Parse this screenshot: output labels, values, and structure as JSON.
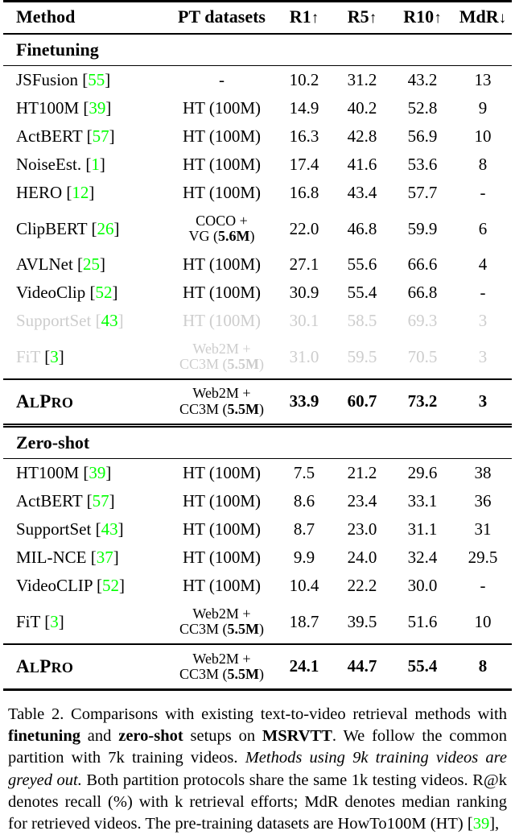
{
  "table": {
    "columns": [
      {
        "key": "method",
        "label": "Method"
      },
      {
        "key": "pt",
        "label": "PT datasets"
      },
      {
        "key": "r1",
        "label": "R1",
        "arrow": "↑"
      },
      {
        "key": "r5",
        "label": "R5",
        "arrow": "↑"
      },
      {
        "key": "r10",
        "label": "R10",
        "arrow": "↑"
      },
      {
        "key": "mdr",
        "label": "MdR",
        "arrow": "↓"
      }
    ],
    "sections": [
      {
        "title": "Finetuning",
        "rows": [
          {
            "name": "JSFusion",
            "cite": "55",
            "pt": "-",
            "r1": "10.2",
            "r5": "31.2",
            "r10": "43.2",
            "mdr": "13"
          },
          {
            "name": "HT100M",
            "cite": "39",
            "pt": "HT (100M)",
            "r1": "14.9",
            "r5": "40.2",
            "r10": "52.8",
            "mdr": "9"
          },
          {
            "name": "ActBERT",
            "cite": "57",
            "pt": "HT (100M)",
            "r1": "16.3",
            "r5": "42.8",
            "r10": "56.9",
            "mdr": "10"
          },
          {
            "name": "NoiseEst.",
            "cite": "1",
            "pt": "HT (100M)",
            "r1": "17.4",
            "r5": "41.6",
            "r10": "53.6",
            "mdr": "8"
          },
          {
            "name": "HERO",
            "cite": "12",
            "pt": "HT (100M)",
            "r1": "16.8",
            "r5": "43.4",
            "r10": "57.7",
            "mdr": "-"
          },
          {
            "name": "ClipBERT",
            "cite": "26",
            "pt_line1": "COCO +",
            "pt_line2_pre": "VG (",
            "pt_line2_bold": "5.6M",
            "pt_line2_post": ")",
            "r1": "22.0",
            "r5": "46.8",
            "r10": "59.9",
            "mdr": "6"
          },
          {
            "name": "AVLNet",
            "cite": "25",
            "pt": "HT (100M)",
            "r1": "27.1",
            "r5": "55.6",
            "r10": "66.6",
            "mdr": "4"
          },
          {
            "name": "VideoClip",
            "cite": "52",
            "pt": "HT (100M)",
            "r1": "30.9",
            "r5": "55.4",
            "r10": "66.8",
            "mdr": "-"
          },
          {
            "name": "SupportSet",
            "cite": "43",
            "pt": "HT (100M)",
            "r1": "30.1",
            "r5": "58.5",
            "r10": "69.3",
            "mdr": "3",
            "greyed": true
          },
          {
            "name": "FiT",
            "cite": "3",
            "pt_line1": "Web2M +",
            "pt_line2_pre": "CC3M (",
            "pt_line2_bold": "5.5M",
            "pt_line2_post": ")",
            "r1": "31.0",
            "r5": "59.5",
            "r10": "70.5",
            "mdr": "3",
            "greyed": true,
            "black_brackets": true
          }
        ],
        "highlight": {
          "name_first": "A",
          "name_mid": "L",
          "name_p": "P",
          "name_rest": "RO",
          "name_plain": "ALPRO",
          "pt_line1": "Web2M +",
          "pt_line2_pre": "CC3M (",
          "pt_line2_bold": "5.5M",
          "pt_line2_post": ")",
          "r1": "33.9",
          "r5": "60.7",
          "r10": "73.2",
          "mdr": "3"
        }
      },
      {
        "title": "Zero-shot",
        "rows": [
          {
            "name": "HT100M",
            "cite": "39",
            "pt": "HT (100M)",
            "r1": "7.5",
            "r5": "21.2",
            "r10": "29.6",
            "mdr": "38"
          },
          {
            "name": "ActBERT",
            "cite": "57",
            "pt": "HT (100M)",
            "r1": "8.6",
            "r5": "23.4",
            "r10": "33.1",
            "mdr": "36"
          },
          {
            "name": "SupportSet",
            "cite": "43",
            "pt": "HT (100M)",
            "r1": "8.7",
            "r5": "23.0",
            "r10": "31.1",
            "mdr": "31"
          },
          {
            "name": "MIL-NCE",
            "cite": "37",
            "pt": "HT (100M)",
            "r1": "9.9",
            "r5": "24.0",
            "r10": "32.4",
            "mdr": "29.5"
          },
          {
            "name": "VideoCLIP",
            "cite": "52",
            "pt": "HT (100M)",
            "r1": "10.4",
            "r5": "22.2",
            "r10": "30.0",
            "mdr": "-"
          },
          {
            "name": "FiT",
            "cite": "3",
            "pt_line1": "Web2M +",
            "pt_line2_pre": "CC3M (",
            "pt_line2_bold": "5.5M",
            "pt_line2_post": ")",
            "r1": "18.7",
            "r5": "39.5",
            "r10": "51.6",
            "mdr": "10"
          }
        ],
        "highlight": {
          "name_first": "A",
          "name_mid": "L",
          "name_p": "P",
          "name_rest": "RO",
          "name_plain": "ALPRO",
          "pt_line1": "Web2M +",
          "pt_line2_pre": "CC3M (",
          "pt_line2_bold": "5.5M",
          "pt_line2_post": ")",
          "r1": "24.1",
          "r5": "44.7",
          "r10": "55.4",
          "mdr": "8"
        }
      }
    ]
  },
  "caption": {
    "label": "Table 2.",
    "t1": " Comparisons with existing text-to-video retrieval methods with ",
    "b1": "finetuning",
    "t2": " and ",
    "b2": "zero-shot",
    "t3": " setups on ",
    "b3": "MSRVTT",
    "t4": ". We follow the common partition with 7k training videos. ",
    "i1": "Methods using 9k training videos are greyed out.",
    "t5": " Both partition protocols share the same 1k testing videos. R@k denotes recall (%) with k retrieval efforts; MdR denotes median ranking for retrieved videos. The pre-training datasets are HowTo100M (HT) ",
    "cite_open": "[",
    "cite_num": "39",
    "cite_close": "],"
  },
  "colors": {
    "citation_green": "#00ff00",
    "greyed_text": "#cdcdcd",
    "text": "#000000",
    "background": "#ffffff"
  }
}
